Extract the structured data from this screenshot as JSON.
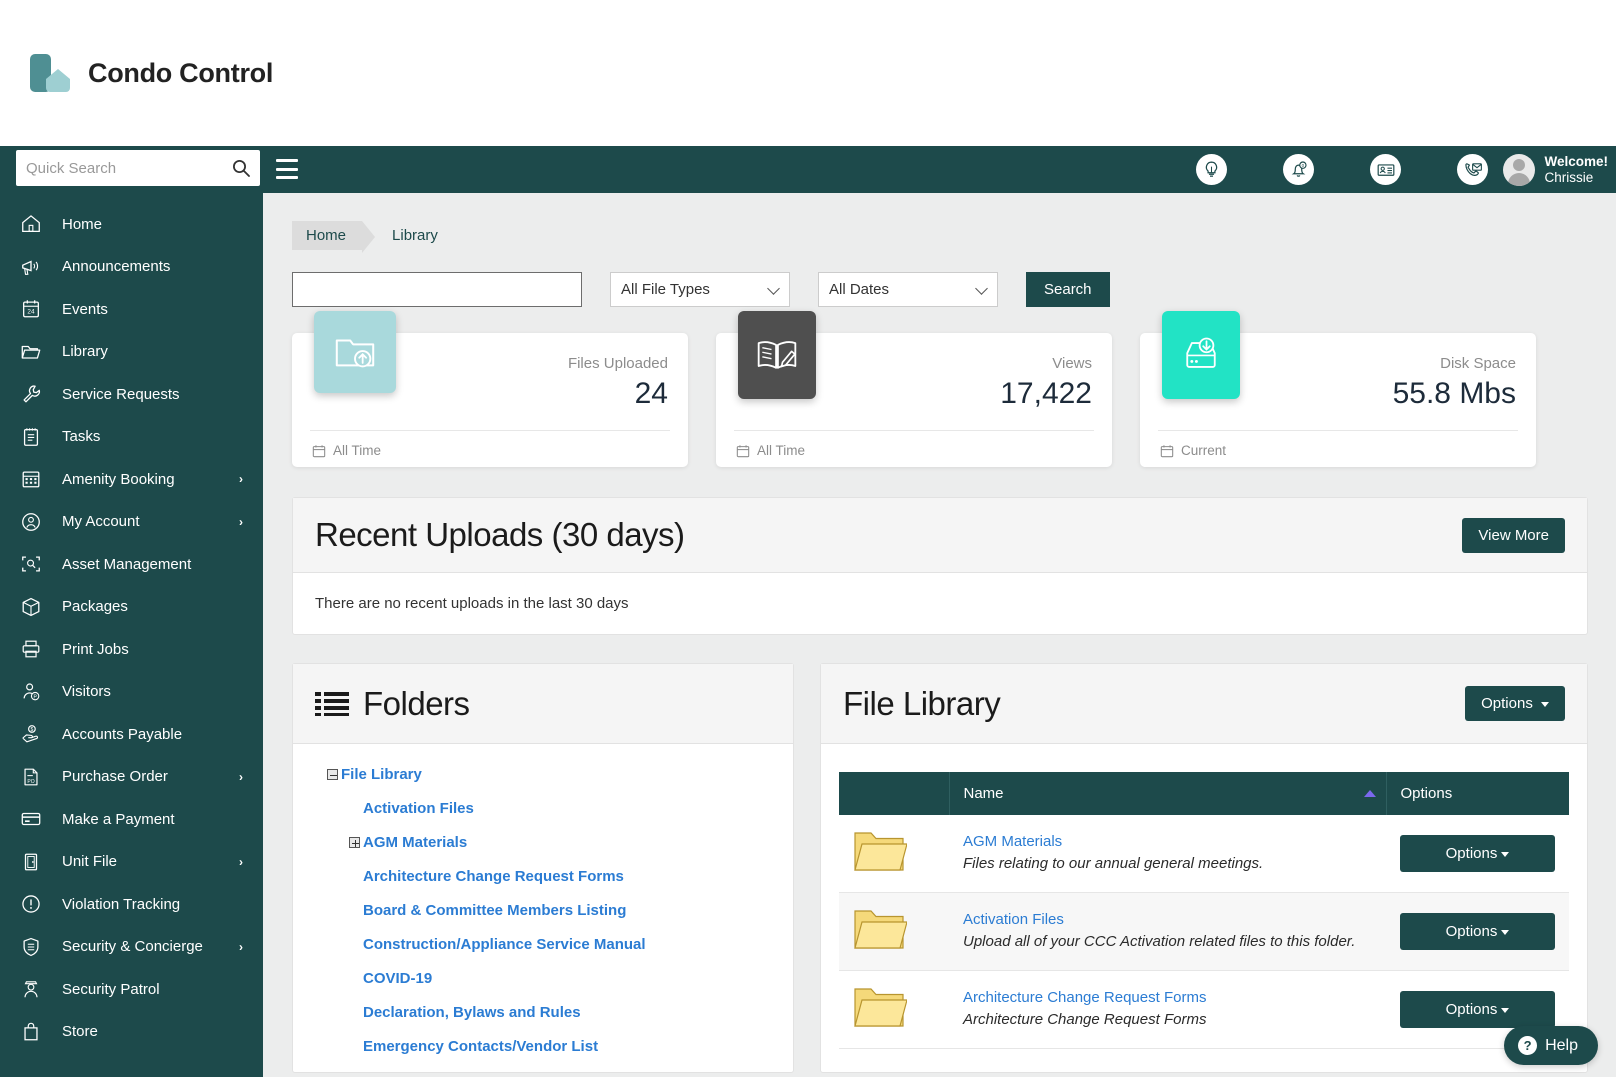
{
  "brand": {
    "name": "Condo Control",
    "logo_icon": "condo-logo-icon",
    "accent": "#4f8f93"
  },
  "topnav": {
    "search_placeholder": "Quick Search",
    "search_value": "",
    "search_icon": "search-icon",
    "menu_icon": "hamburger-menu-icon",
    "icons": [
      {
        "name": "lightbulb-icon",
        "label": "Ideas"
      },
      {
        "name": "bell-notification-icon",
        "label": "Notifications",
        "badge": "0"
      },
      {
        "name": "contact-card-icon",
        "label": "Directory"
      },
      {
        "name": "phone-envelope-icon",
        "label": "Messages"
      }
    ],
    "welcome_line1": "Welcome!",
    "welcome_line2": "Chrissie",
    "avatar_icon": "user-avatar-icon"
  },
  "sidebar": {
    "items": [
      {
        "label": "Home",
        "icon": "home-icon",
        "caret": false
      },
      {
        "label": "Announcements",
        "icon": "megaphone-icon",
        "caret": false
      },
      {
        "label": "Events",
        "icon": "calendar-24-icon",
        "caret": false
      },
      {
        "label": "Library",
        "icon": "folder-icon",
        "caret": false
      },
      {
        "label": "Service Requests",
        "icon": "wrench-icon",
        "caret": false
      },
      {
        "label": "Tasks",
        "icon": "clipboard-list-icon",
        "caret": false
      },
      {
        "label": "Amenity Booking",
        "icon": "calendar-grid-icon",
        "caret": true
      },
      {
        "label": "My Account",
        "icon": "user-circle-icon",
        "caret": true
      },
      {
        "label": "Asset Management",
        "icon": "asset-scan-icon",
        "caret": false
      },
      {
        "label": "Packages",
        "icon": "package-box-icon",
        "caret": false
      },
      {
        "label": "Print Jobs",
        "icon": "printer-icon",
        "caret": false
      },
      {
        "label": "Visitors",
        "icon": "visitor-parking-icon",
        "caret": false
      },
      {
        "label": "Accounts Payable",
        "icon": "hand-dollar-icon",
        "caret": false
      },
      {
        "label": "Purchase Order",
        "icon": "po-document-icon",
        "caret": true
      },
      {
        "label": "Make a Payment",
        "icon": "credit-card-icon",
        "caret": false
      },
      {
        "label": "Unit File",
        "icon": "door-icon",
        "caret": true
      },
      {
        "label": "Violation Tracking",
        "icon": "exclamation-circle-icon",
        "caret": false
      },
      {
        "label": "Security & Concierge",
        "icon": "shield-lines-icon",
        "caret": true
      },
      {
        "label": "Security Patrol",
        "icon": "guard-officer-icon",
        "caret": false
      },
      {
        "label": "Store",
        "icon": "shopping-bag-icon",
        "caret": false
      }
    ]
  },
  "breadcrumb": {
    "home": "Home",
    "current": "Library"
  },
  "filters": {
    "keyword_value": "",
    "keyword_placeholder": "",
    "file_type": "All File Types",
    "date_range": "All Dates",
    "search_button": "Search"
  },
  "stats": [
    {
      "label": "Files Uploaded",
      "value": "24",
      "footer": "All Time",
      "icon": "folder-upload-icon",
      "badge_color": "#a9d9dc"
    },
    {
      "label": "Views",
      "value": "17,422",
      "footer": "All Time",
      "icon": "book-edit-icon",
      "badge_color": "#4f4f4f"
    },
    {
      "label": "Disk Space",
      "value": "55.8 Mbs",
      "footer": "Current",
      "icon": "disk-download-icon",
      "badge_color": "#22e3c5"
    }
  ],
  "recent_uploads": {
    "title": "Recent Uploads (30 days)",
    "view_more": "View More",
    "empty_message": "There are no recent uploads in the last 30 days"
  },
  "folders_panel": {
    "title": "Folders",
    "icon": "list-bullets-icon",
    "tree": [
      {
        "label": "File Library",
        "toggle": "minus",
        "indent": 0
      },
      {
        "label": "Activation Files",
        "toggle": "none",
        "indent": 1
      },
      {
        "label": "AGM Materials",
        "toggle": "plus",
        "indent": 1
      },
      {
        "label": "Architecture Change Request Forms",
        "toggle": "none",
        "indent": 1
      },
      {
        "label": "Board & Committee Members Listing",
        "toggle": "none",
        "indent": 1
      },
      {
        "label": "Construction/Appliance Service Manual",
        "toggle": "none",
        "indent": 1
      },
      {
        "label": "COVID-19",
        "toggle": "none",
        "indent": 1
      },
      {
        "label": "Declaration, Bylaws and Rules",
        "toggle": "none",
        "indent": 1
      },
      {
        "label": "Emergency Contacts/Vendor List",
        "toggle": "none",
        "indent": 1
      }
    ]
  },
  "file_library": {
    "title": "File Library",
    "options_button": "Options",
    "columns": {
      "icon": "",
      "name": "Name",
      "options": "Options"
    },
    "sort": {
      "column": "Name",
      "direction": "asc",
      "arrow_color": "#7b68ee"
    },
    "rows": [
      {
        "icon": "folder-yellow-icon",
        "name": "AGM Materials",
        "description": "Files relating to our annual general meetings.",
        "options_label": "Options"
      },
      {
        "icon": "folder-yellow-icon",
        "name": "Activation Files",
        "description": "Upload all of your CCC Activation related files to this folder.",
        "options_label": "Options"
      },
      {
        "icon": "folder-yellow-icon",
        "name": "Architecture Change Request Forms",
        "description": "Architecture Change Request Forms",
        "options_label": "Options"
      }
    ]
  },
  "help_widget": {
    "label": "Help",
    "icon": "question-circle-icon"
  }
}
